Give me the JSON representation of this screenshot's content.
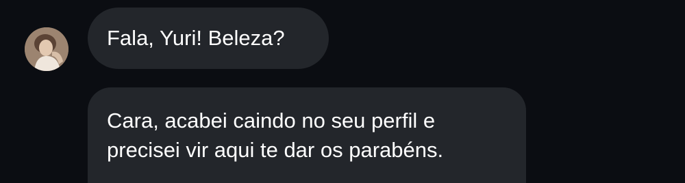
{
  "messages": [
    {
      "sender": "other",
      "lines": [
        "Fala, Yuri! Beleza?"
      ]
    },
    {
      "sender": "other",
      "lines": [
        "Cara, acabei caindo no seu perfil e",
        "precisei vir aqui te dar os parabéns."
      ]
    }
  ],
  "avatar": {
    "icon": "user-photo-avatar"
  },
  "colors": {
    "background": "#0b0d12",
    "bubble": "#23262b",
    "text": "#ffffff"
  }
}
